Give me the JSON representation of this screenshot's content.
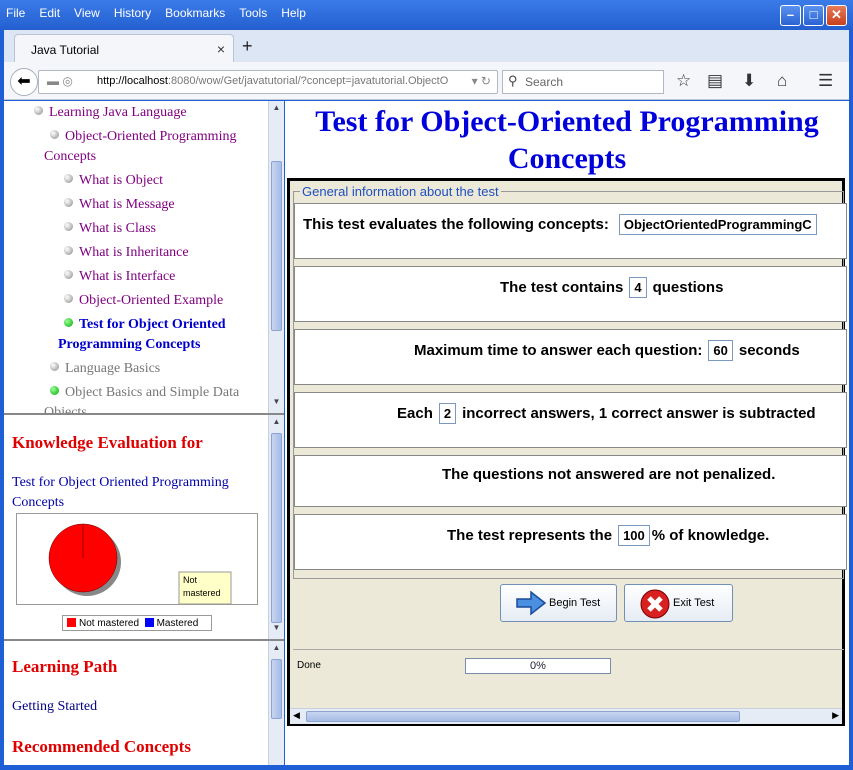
{
  "menu": [
    "File",
    "Edit",
    "View",
    "History",
    "Bookmarks",
    "Tools",
    "Help"
  ],
  "tab": {
    "title": "Java Tutorial",
    "close": "×",
    "new": "+"
  },
  "url": {
    "host": "http://localhost",
    "path": ":8080/wow/Get/javatutorial/?concept=javatutorial.ObjectO"
  },
  "search": {
    "placeholder": "Search"
  },
  "sidebar": {
    "tree": [
      {
        "label": "Learning Java Language",
        "style": "normal"
      },
      {
        "label": "Object-Oriented Programming",
        "label2": "Concepts",
        "style": "normal"
      },
      {
        "label": "What is Object",
        "style": "normal"
      },
      {
        "label": "What is Message",
        "style": "normal"
      },
      {
        "label": "What is Class",
        "style": "normal"
      },
      {
        "label": "What is Inheritance",
        "style": "normal"
      },
      {
        "label": "What is Interface",
        "style": "normal"
      },
      {
        "label": "Object-Oriented Example",
        "style": "normal"
      },
      {
        "label": "Test for Object Oriented",
        "label2": "Programming Concepts",
        "style": "active"
      },
      {
        "label": "Language Basics",
        "style": "gray"
      },
      {
        "label": "Object Basics and Simple Data",
        "label2": "Objects",
        "style": "gray"
      }
    ],
    "knowledge": {
      "heading": "Knowledge Evaluation for",
      "link1": "Test for Object Oriented Programming",
      "link2": "Concepts"
    },
    "learning": {
      "heading": "Learning Path",
      "link": "Getting Started",
      "heading2": "Recommended Concepts"
    }
  },
  "chart_data": {
    "type": "pie",
    "categories": [
      "Not mastered",
      "Mastered"
    ],
    "values": [
      100,
      0
    ],
    "colors": [
      "#ff0000",
      "#0000ff"
    ],
    "tooltip": [
      "Not",
      "mastered"
    ],
    "legend_placement": "bottom"
  },
  "main": {
    "title": "Test for Object-Oriented Programming Concepts",
    "group": "General information about the test",
    "rows": {
      "concepts": {
        "pre": "This test evaluates the following concepts:",
        "value": "ObjectOrientedProgrammingC"
      },
      "questions": {
        "pre": "The test contains",
        "value": "4",
        "post": "questions"
      },
      "time": {
        "pre": "Maximum time to answer each question:",
        "value": "60",
        "post": "seconds"
      },
      "penalty": {
        "pre": "Each",
        "value": "2",
        "post": "incorrect answers, 1 correct answer is subtracted"
      },
      "unanswered": {
        "text": "The questions not answered are not penalized."
      },
      "knowledge": {
        "pre": "The test represents the",
        "value": "100",
        "post": "% of knowledge."
      }
    },
    "buttons": {
      "begin": "Begin Test",
      "exit": "Exit Test"
    },
    "status": {
      "text": "Done",
      "progress": "0%",
      "progress_value": 0
    }
  }
}
